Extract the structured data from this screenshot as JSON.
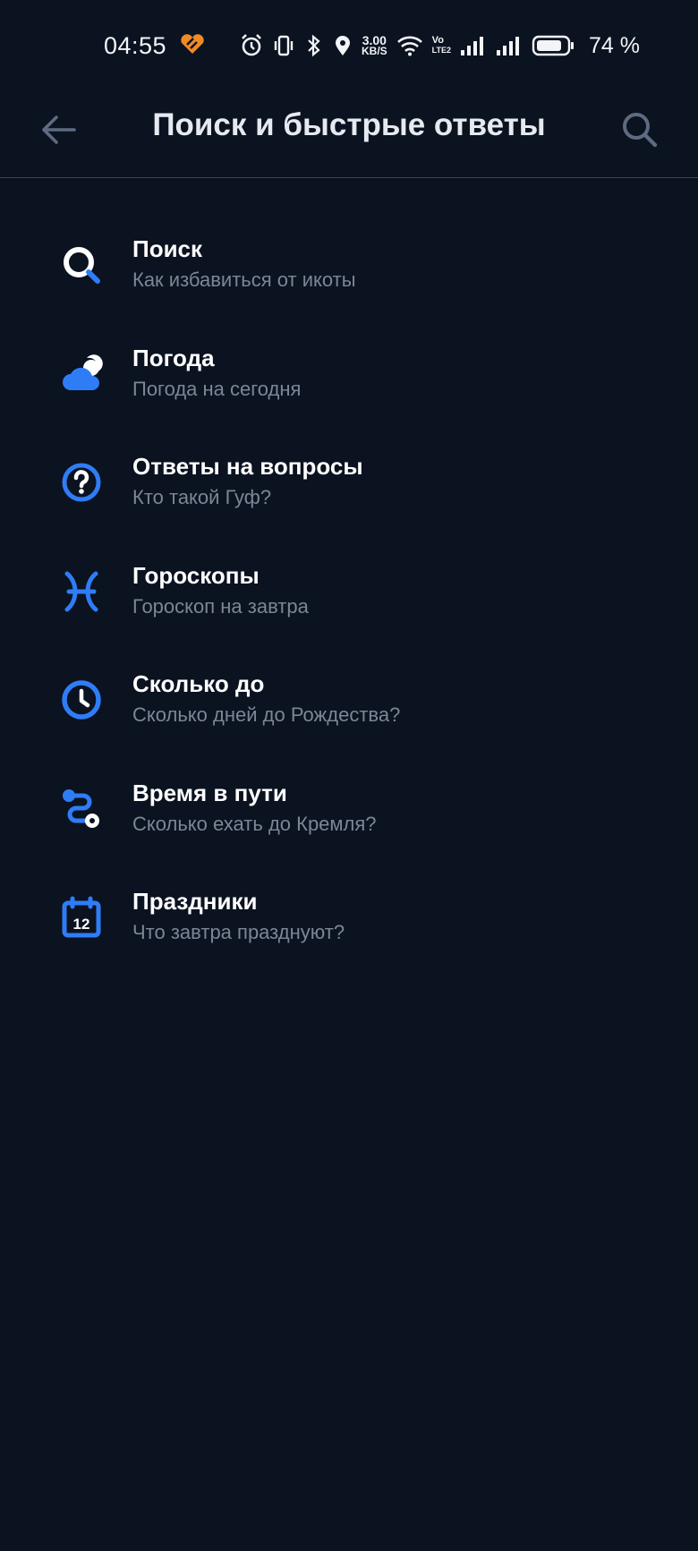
{
  "status_bar": {
    "time": "04:55",
    "net_speed_value": "3.00",
    "net_speed_unit": "KB/S",
    "volte_top": "Vo",
    "volte_bottom": "LTE2",
    "battery_percent": "74 %"
  },
  "app_bar": {
    "title": "Поиск и быстрые ответы",
    "back_icon": "arrow-left-icon",
    "search_icon": "search-icon"
  },
  "colors": {
    "background": "#0b1220",
    "accent": "#2f7df6",
    "title_text": "#ffffff",
    "subtitle_text": "#7c8696",
    "divider": "#3a4659"
  },
  "items": [
    {
      "icon": "search-icon",
      "title": "Поиск",
      "subtitle": "Как избавиться от икоты"
    },
    {
      "icon": "weather-icon",
      "title": "Погода",
      "subtitle": "Погода на сегодня"
    },
    {
      "icon": "question-icon",
      "title": "Ответы на вопросы",
      "subtitle": "Кто такой Гуф?"
    },
    {
      "icon": "pisces-icon",
      "title": "Гороскопы",
      "subtitle": "Гороскоп на завтра"
    },
    {
      "icon": "clock-icon",
      "title": "Сколько до",
      "subtitle": "Сколько дней до Рождества?"
    },
    {
      "icon": "route-icon",
      "title": "Время в пути",
      "subtitle": "Сколько ехать до Кремля?"
    },
    {
      "icon": "calendar-icon",
      "title": "Праздники",
      "subtitle": "Что завтра празднуют?",
      "calendar_day": "12"
    }
  ]
}
